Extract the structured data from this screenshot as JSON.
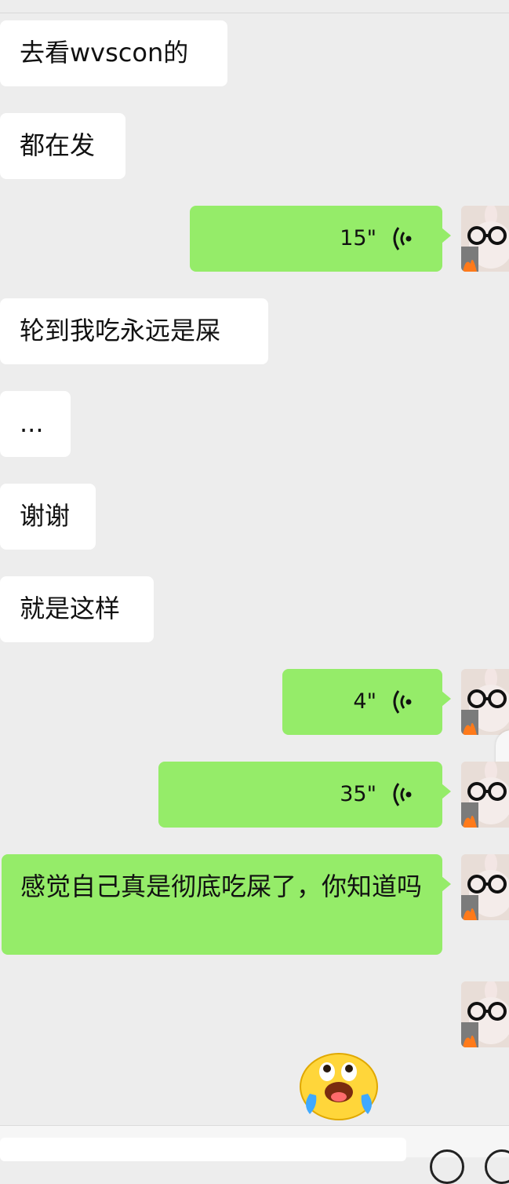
{
  "messages": {
    "m1": "去看wvscon的",
    "m2": "都在发",
    "v1": "15\"",
    "m3": "轮到我吃永远是屎",
    "m4": "...",
    "m5": "谢谢",
    "m6": "就是这样",
    "v2": "4\"",
    "v3": "35\"",
    "m7": "感觉自己真是彻底吃屎了，你知道吗"
  },
  "icons": {
    "voice": "voice-wave-icon",
    "emoji": "crying-laughing-emoji-icon",
    "avatar": "bunny-glasses-avatar"
  },
  "colors": {
    "background": "#ededed",
    "incoming_bubble": "#ffffff",
    "outgoing_bubble": "#95ec69"
  }
}
